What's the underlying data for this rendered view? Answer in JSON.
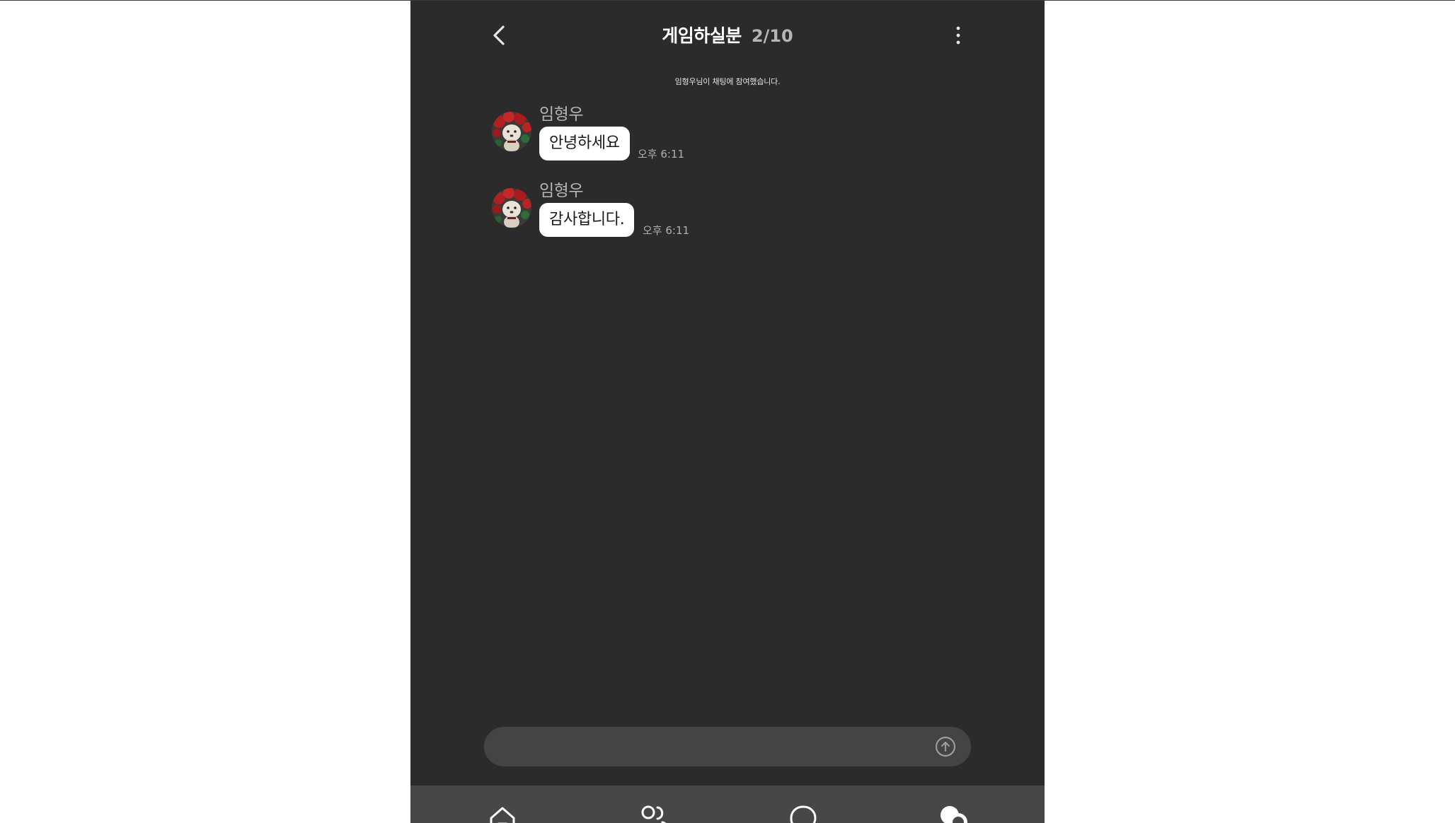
{
  "header": {
    "title": "게임하실분",
    "member_count": "2/10",
    "back_icon": "chevron-left-icon",
    "more_icon": "more-vertical-icon"
  },
  "chat": {
    "system_message": "임형우님이 채팅에 참여했습니다.",
    "messages": [
      {
        "sender": "임형우",
        "text": "안녕하세요",
        "time": "오후 6:11"
      },
      {
        "sender": "임형우",
        "text": "감사합니다.",
        "time": "오후 6:11"
      }
    ]
  },
  "composer": {
    "value": "",
    "placeholder": "",
    "send_icon": "arrow-up-circle-icon"
  },
  "bottom_nav": {
    "items": [
      {
        "icon": "home-icon"
      },
      {
        "icon": "users-icon"
      },
      {
        "icon": "chat-bubble-icon"
      },
      {
        "icon": "chats-filled-icon",
        "active": true
      }
    ]
  },
  "colors": {
    "background": "#2b2b2b",
    "bubble": "#ffffff",
    "input": "#444444",
    "nav": "#474747"
  }
}
